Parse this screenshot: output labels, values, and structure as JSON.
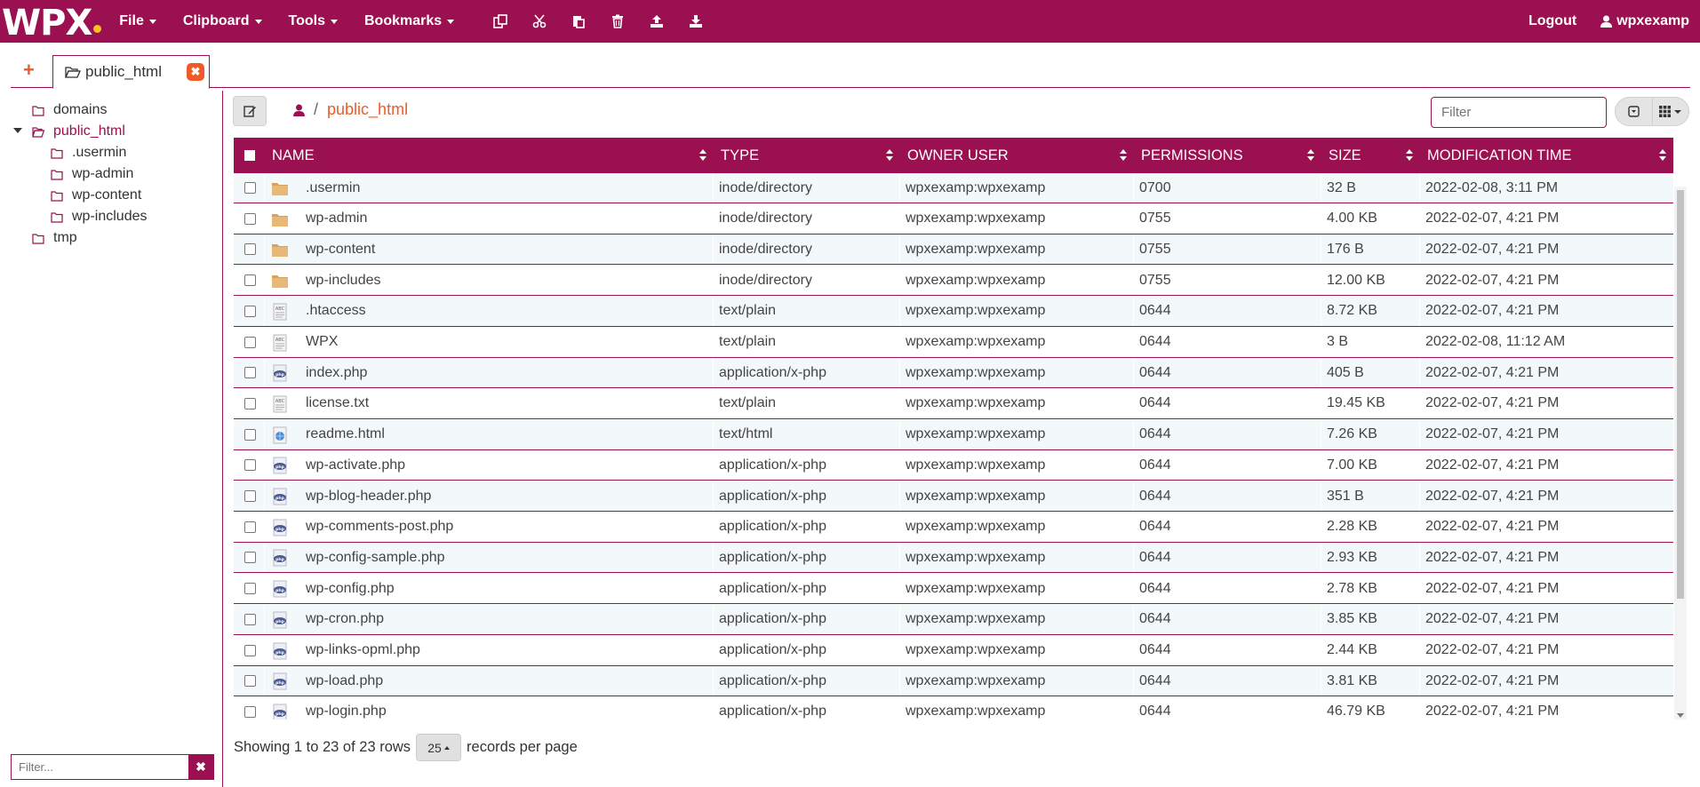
{
  "brand": {
    "logo_text": "WPX",
    "accent": "#9b1050",
    "dot_color": "#f6c41a",
    "highlight": "#f05a28"
  },
  "menu": [
    {
      "label": "File"
    },
    {
      "label": "Clipboard"
    },
    {
      "label": "Tools"
    },
    {
      "label": "Bookmarks"
    }
  ],
  "toolbar_icons": [
    "copy-icon",
    "cut-icon",
    "paste-icon",
    "trash-icon",
    "upload-icon",
    "download-icon"
  ],
  "top_right": {
    "logout": "Logout",
    "username": "wpxexamp"
  },
  "tabs": {
    "add": "+",
    "active": "public_html",
    "close": "✖"
  },
  "tree": {
    "items": [
      {
        "label": "domains"
      },
      {
        "label": "public_html"
      },
      {
        "label": ".usermin"
      },
      {
        "label": "wp-admin"
      },
      {
        "label": "wp-content"
      },
      {
        "label": "wp-includes"
      },
      {
        "label": "tmp"
      }
    ],
    "filter_placeholder": "Filter...",
    "filter_clear": "✖"
  },
  "breadcrumb": {
    "separator": "/",
    "current": "public_html"
  },
  "filter": {
    "placeholder": "Filter"
  },
  "table": {
    "headers": {
      "name": "NAME",
      "type": "TYPE",
      "owner": "OWNER USER",
      "permissions": "PERMISSIONS",
      "size": "SIZE",
      "modified": "MODIFICATION TIME"
    },
    "rows": [
      {
        "icon": "folder",
        "name": ".usermin",
        "type": "inode/directory",
        "owner": "wpxexamp:wpxexamp",
        "perm": "0700",
        "size": "32 B",
        "mtime": "2022-02-08, 3:11 PM"
      },
      {
        "icon": "folder",
        "name": "wp-admin",
        "type": "inode/directory",
        "owner": "wpxexamp:wpxexamp",
        "perm": "0755",
        "size": "4.00 KB",
        "mtime": "2022-02-07, 4:21 PM"
      },
      {
        "icon": "folder",
        "name": "wp-content",
        "type": "inode/directory",
        "owner": "wpxexamp:wpxexamp",
        "perm": "0755",
        "size": "176 B",
        "mtime": "2022-02-07, 4:21 PM"
      },
      {
        "icon": "folder",
        "name": "wp-includes",
        "type": "inode/directory",
        "owner": "wpxexamp:wpxexamp",
        "perm": "0755",
        "size": "12.00 KB",
        "mtime": "2022-02-07, 4:21 PM"
      },
      {
        "icon": "text",
        "name": ".htaccess",
        "type": "text/plain",
        "owner": "wpxexamp:wpxexamp",
        "perm": "0644",
        "size": "8.72 KB",
        "mtime": "2022-02-07, 4:21 PM"
      },
      {
        "icon": "text",
        "name": "WPX",
        "type": "text/plain",
        "owner": "wpxexamp:wpxexamp",
        "perm": "0644",
        "size": "3 B",
        "mtime": "2022-02-08, 11:12 AM"
      },
      {
        "icon": "php",
        "name": "index.php",
        "type": "application/x-php",
        "owner": "wpxexamp:wpxexamp",
        "perm": "0644",
        "size": "405 B",
        "mtime": "2022-02-07, 4:21 PM"
      },
      {
        "icon": "text",
        "name": "license.txt",
        "type": "text/plain",
        "owner": "wpxexamp:wpxexamp",
        "perm": "0644",
        "size": "19.45 KB",
        "mtime": "2022-02-07, 4:21 PM"
      },
      {
        "icon": "html",
        "name": "readme.html",
        "type": "text/html",
        "owner": "wpxexamp:wpxexamp",
        "perm": "0644",
        "size": "7.26 KB",
        "mtime": "2022-02-07, 4:21 PM"
      },
      {
        "icon": "php",
        "name": "wp-activate.php",
        "type": "application/x-php",
        "owner": "wpxexamp:wpxexamp",
        "perm": "0644",
        "size": "7.00 KB",
        "mtime": "2022-02-07, 4:21 PM"
      },
      {
        "icon": "php",
        "name": "wp-blog-header.php",
        "type": "application/x-php",
        "owner": "wpxexamp:wpxexamp",
        "perm": "0644",
        "size": "351 B",
        "mtime": "2022-02-07, 4:21 PM"
      },
      {
        "icon": "php",
        "name": "wp-comments-post.php",
        "type": "application/x-php",
        "owner": "wpxexamp:wpxexamp",
        "perm": "0644",
        "size": "2.28 KB",
        "mtime": "2022-02-07, 4:21 PM"
      },
      {
        "icon": "php",
        "name": "wp-config-sample.php",
        "type": "application/x-php",
        "owner": "wpxexamp:wpxexamp",
        "perm": "0644",
        "size": "2.93 KB",
        "mtime": "2022-02-07, 4:21 PM"
      },
      {
        "icon": "php",
        "name": "wp-config.php",
        "type": "application/x-php",
        "owner": "wpxexamp:wpxexamp",
        "perm": "0644",
        "size": "2.78 KB",
        "mtime": "2022-02-07, 4:21 PM"
      },
      {
        "icon": "php",
        "name": "wp-cron.php",
        "type": "application/x-php",
        "owner": "wpxexamp:wpxexamp",
        "perm": "0644",
        "size": "3.85 KB",
        "mtime": "2022-02-07, 4:21 PM"
      },
      {
        "icon": "php",
        "name": "wp-links-opml.php",
        "type": "application/x-php",
        "owner": "wpxexamp:wpxexamp",
        "perm": "0644",
        "size": "2.44 KB",
        "mtime": "2022-02-07, 4:21 PM"
      },
      {
        "icon": "php",
        "name": "wp-load.php",
        "type": "application/x-php",
        "owner": "wpxexamp:wpxexamp",
        "perm": "0644",
        "size": "3.81 KB",
        "mtime": "2022-02-07, 4:21 PM"
      },
      {
        "icon": "php",
        "name": "wp-login.php",
        "type": "application/x-php",
        "owner": "wpxexamp:wpxexamp",
        "perm": "0644",
        "size": "46.79 KB",
        "mtime": "2022-02-07, 4:21 PM"
      }
    ]
  },
  "footer": {
    "showing": "Showing 1 to 23 of 23 rows",
    "page_size": "25",
    "per_page": "records per page"
  }
}
